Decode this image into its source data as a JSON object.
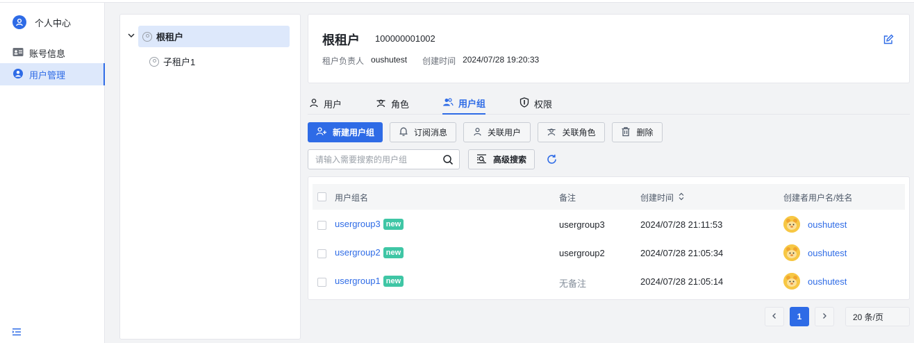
{
  "sidebar": {
    "header": "个人中心",
    "items": [
      {
        "label": "账号信息",
        "icon": "id-card-icon"
      },
      {
        "label": "用户管理",
        "icon": "user-circle-icon"
      }
    ]
  },
  "tree": {
    "root": "根租户",
    "child": "子租户1"
  },
  "tenant": {
    "name": "根租户",
    "id": "100000001002",
    "owner_label": "租户负责人",
    "owner": "oushutest",
    "created_label": "创建时间",
    "created": "2024/07/28 19:20:33"
  },
  "tabs": [
    {
      "label": "用户"
    },
    {
      "label": "角色"
    },
    {
      "label": "用户组"
    },
    {
      "label": "权限"
    }
  ],
  "toolbar": {
    "new_group": "新建用户组",
    "subscribe": "订阅消息",
    "link_user": "关联用户",
    "link_role": "关联角色",
    "delete": "删除",
    "advanced_search": "高级搜索"
  },
  "search": {
    "placeholder": "请输入需要搜索的用户组"
  },
  "table": {
    "columns": [
      "用户组名",
      "备注",
      "创建时间",
      "创建者用户名/姓名"
    ],
    "rows": [
      {
        "name": "usergroup3",
        "badge": "new",
        "note": "usergroup3",
        "created": "2024/07/28 21:11:53",
        "creator": "oushutest"
      },
      {
        "name": "usergroup2",
        "badge": "new",
        "note": "usergroup2",
        "created": "2024/07/28 21:05:34",
        "creator": "oushutest"
      },
      {
        "name": "usergroup1",
        "badge": "new",
        "note": "无备注",
        "created": "2024/07/28 21:05:14",
        "creator": "oushutest"
      }
    ]
  },
  "pagination": {
    "current": "1",
    "page_size": "20 条/页"
  },
  "colors": {
    "primary": "#2e6be6",
    "badge": "#3fc6a5",
    "active_bg": "#dde8fb"
  }
}
